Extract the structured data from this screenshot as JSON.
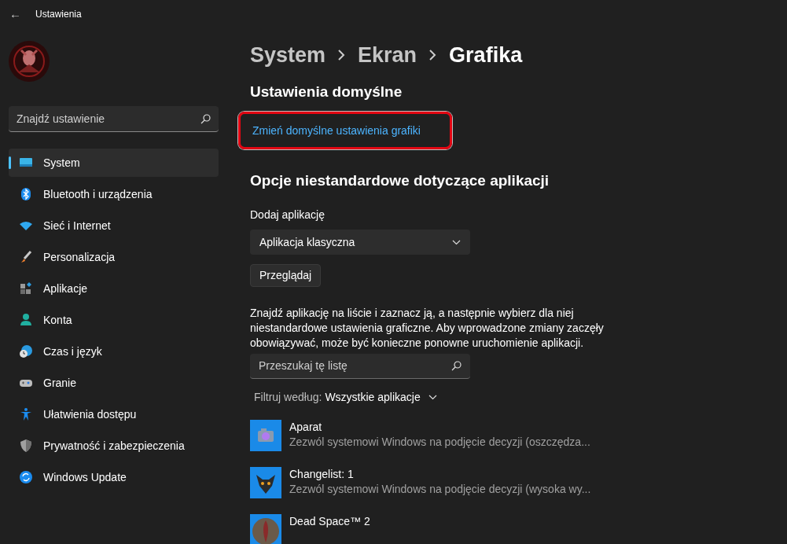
{
  "window": {
    "title": "Ustawienia",
    "back": "←"
  },
  "sidebar": {
    "search": {
      "placeholder": "Znajdź ustawienie"
    },
    "items": [
      {
        "label": "System",
        "selected": true
      },
      {
        "label": "Bluetooth i urządzenia",
        "selected": false
      },
      {
        "label": "Sieć i Internet",
        "selected": false
      },
      {
        "label": "Personalizacja",
        "selected": false
      },
      {
        "label": "Aplikacje",
        "selected": false
      },
      {
        "label": "Konta",
        "selected": false
      },
      {
        "label": "Czas i język",
        "selected": false
      },
      {
        "label": "Granie",
        "selected": false
      },
      {
        "label": "Ułatwienia dostępu",
        "selected": false
      },
      {
        "label": "Prywatność i zabezpieczenia",
        "selected": false
      },
      {
        "label": "Windows Update",
        "selected": false
      }
    ]
  },
  "breadcrumb": [
    "System",
    "Ekran",
    "Grafika"
  ],
  "default_section": {
    "heading": "Ustawienia domyślne",
    "link": "Zmień domyślne ustawienia grafiki",
    "highlighted": true
  },
  "custom_section": {
    "heading": "Opcje niestandardowe dotyczące aplikacji",
    "add_label": "Dodaj aplikację",
    "app_type": "Aplikacja klasyczna",
    "browse_button": "Przeglądaj",
    "description": "Znajdź aplikację na liście i zaznacz ją, a następnie wybierz dla niej niestandardowe ustawienia graficzne. Aby wprowadzone zmiany zaczęły obowiązywać, może być konieczne ponowne uruchomienie aplikacji.",
    "search": {
      "placeholder": "Przeszukaj tę listę"
    },
    "filter_label": "Filtruj według:",
    "filter_value": "Wszystkie aplikacje",
    "apps": [
      {
        "name": "Aparat",
        "setting": "Zezwól systemowi Windows na podjęcie decyzji (oszczędza..."
      },
      {
        "name": "Changelist: 1",
        "setting": "Zezwól systemowi Windows na podjęcie decyzji (wysoka wy..."
      },
      {
        "name": "Dead Space™ 2"
      }
    ]
  }
}
